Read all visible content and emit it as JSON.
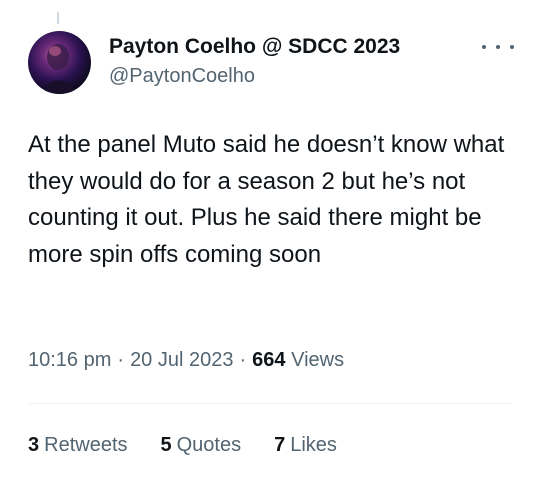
{
  "author": {
    "display_name": "Payton Coelho @ SDCC 2023",
    "handle": "@PaytonCoelho"
  },
  "tweet": {
    "text": "At the panel Muto said he doesn’t know what they would do for a season 2 but he’s not counting it out. Plus he said there might be more spin offs coming soon"
  },
  "meta": {
    "time": "10:16 pm",
    "separator": "·",
    "date": "20 Jul 2023",
    "views_count": "664",
    "views_label": "Views"
  },
  "stats": {
    "retweets_count": "3",
    "retweets_label": "Retweets",
    "quotes_count": "5",
    "quotes_label": "Quotes",
    "likes_count": "7",
    "likes_label": "Likes"
  },
  "icons": {
    "more": "more-horizontal-icon"
  },
  "colors": {
    "primary_text": "#0f1419",
    "secondary_text": "#536471",
    "divider": "#eff3f4"
  }
}
